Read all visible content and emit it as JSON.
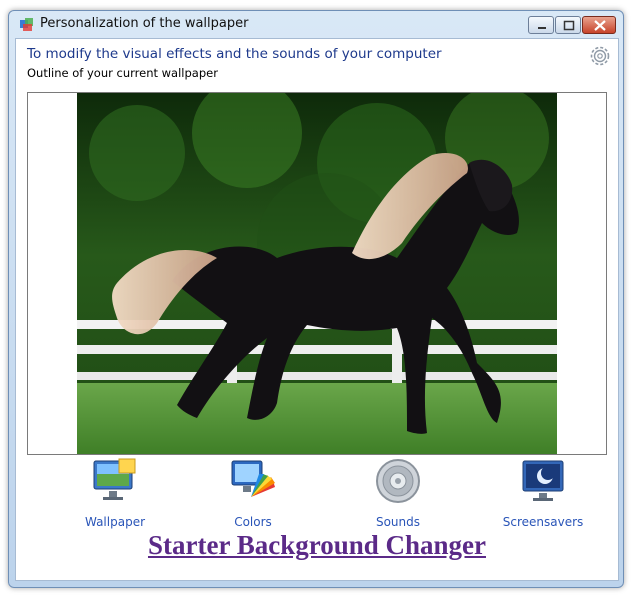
{
  "window": {
    "title": "Personalization of the wallpaper",
    "controls": [
      "minimize-icon",
      "maximize-icon",
      "close-icon"
    ]
  },
  "header": {
    "headline": "To modify the visual effects and the sounds of your computer",
    "subheadline": "Outline of your current wallpaper",
    "settings_icon": "gear-icon"
  },
  "preview": {
    "image": "black horse with blonde mane galloping on grass in front of white fence"
  },
  "tiles": [
    {
      "label": "Wallpaper",
      "icon": "wallpaper-icon"
    },
    {
      "label": "Colors",
      "icon": "colors-icon"
    },
    {
      "label": "Sounds",
      "icon": "speaker-icon"
    },
    {
      "label": "Screensavers",
      "icon": "screensaver-icon"
    }
  ],
  "footer": {
    "link_text": "Starter Background Changer"
  },
  "colors": {
    "headline": "#1e3a8c",
    "tile_label": "#2a55b8",
    "link": "#5b2a88"
  }
}
